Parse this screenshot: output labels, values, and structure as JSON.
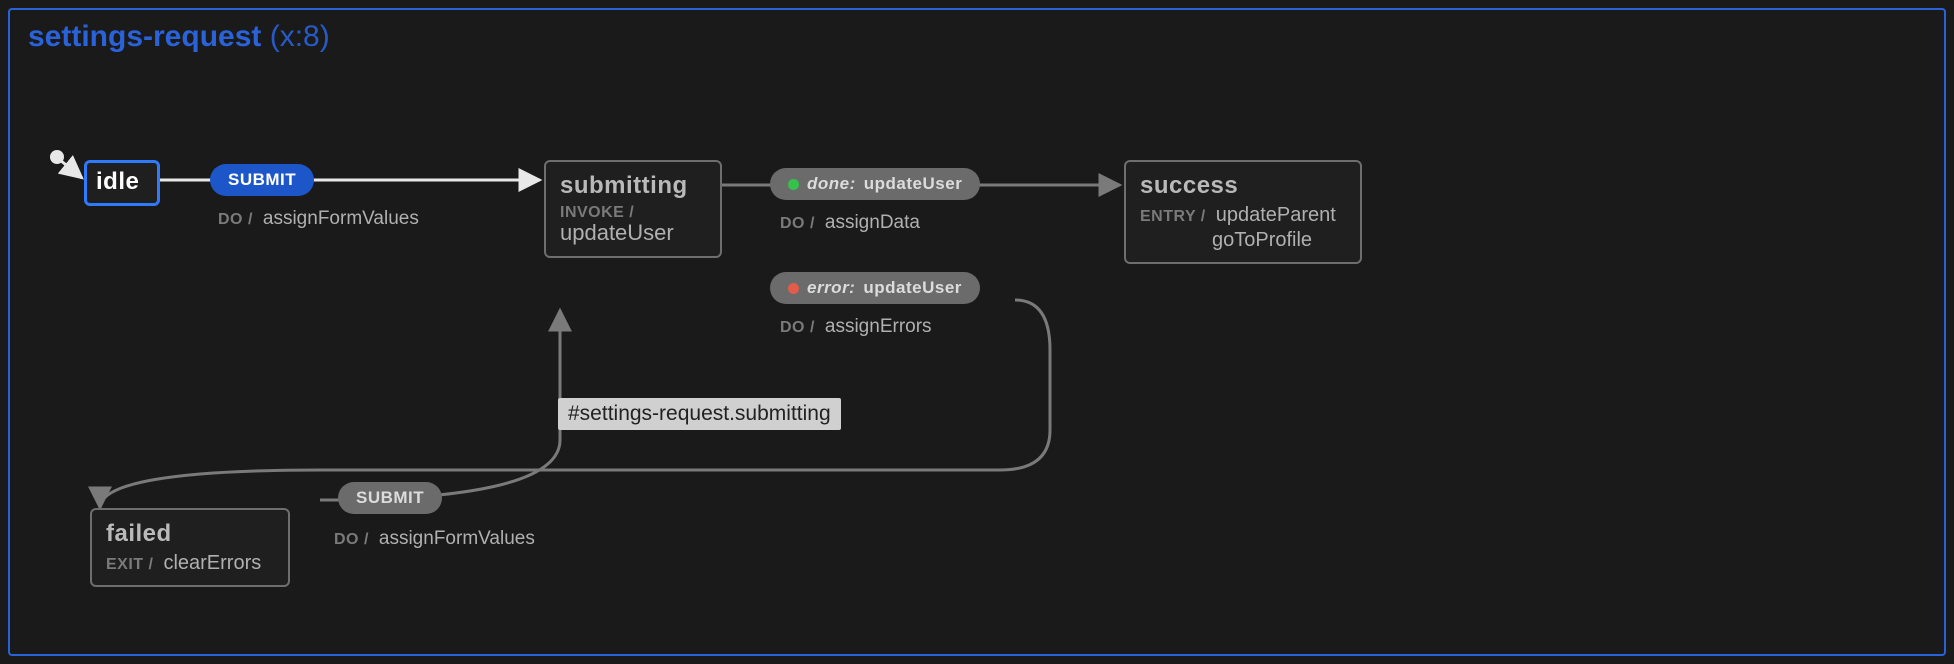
{
  "machine": {
    "name": "settings-request",
    "annotation": "(x:8)"
  },
  "states": {
    "idle": {
      "name": "idle"
    },
    "submitting": {
      "name": "submitting",
      "invoke_key": "INVOKE /",
      "invoke_val": "updateUser"
    },
    "success": {
      "name": "success",
      "entry_key": "ENTRY /",
      "entry_val1": "updateParent",
      "entry_val2": "goToProfile"
    },
    "failed": {
      "name": "failed",
      "exit_key": "EXIT /",
      "exit_val": "clearErrors"
    }
  },
  "transitions": {
    "idle_submit": {
      "event": "SUBMIT",
      "do_key": "DO /",
      "do_val": "assignFormValues"
    },
    "done": {
      "kw": "done:",
      "label": "updateUser",
      "do_key": "DO /",
      "do_val": "assignData"
    },
    "error": {
      "kw": "error:",
      "label": "updateUser",
      "do_key": "DO /",
      "do_val": "assignErrors"
    },
    "failed_submit": {
      "event": "SUBMIT",
      "do_key": "DO /",
      "do_val": "assignFormValues"
    }
  },
  "tooltip": {
    "text": "#settings-request.submitting"
  }
}
